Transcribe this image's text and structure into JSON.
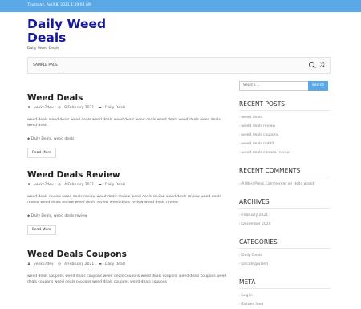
{
  "topbar": {
    "date": "Thursday, April 8, 2021 1:59:04 AM"
  },
  "site": {
    "title": "Daily Weed Deals",
    "tagline": "Daily Weed Deals"
  },
  "nav": {
    "sample_page": "SAMPLE PAGE"
  },
  "posts": [
    {
      "title": "Weed Deals",
      "author": "venko7dev",
      "date": "8 February 2021",
      "category": "Daily Deals",
      "excerpt": "weed deals weed deals weed deals weed deals weed deals weed deals weed deals weed deals weed deals weed deals",
      "tags": "Daily Deals, weed deals",
      "read_more": "Read More"
    },
    {
      "title": "Weed Deals Review",
      "author": "venko7dev",
      "date": "4 February 2021",
      "category": "Daily Deals",
      "excerpt": "weed deals review weed deals review weed deals review weed deals review weed deals review weed deals review weed deals review weed deals review weed deals review weed deals review",
      "tags": "Daily Deals, weed deals review",
      "read_more": "Read More"
    },
    {
      "title": "Weed Deals Coupons",
      "author": "venko7dev",
      "date": "4 February 2021",
      "category": "Daily Deals",
      "excerpt": "weed deals coupons weed deals coupons weed deals coupons weed deals coupons weed deals coupons weed deals coupons weed deals coupons weed deals coupons weed deals coupons",
      "tags": "",
      "read_more": ""
    }
  ],
  "sidebar": {
    "search_placeholder": "Search ...",
    "search_button": "Search",
    "recent_posts_title": "RECENT POSTS",
    "recent_posts": [
      "weed deals",
      "weed deals review",
      "weed deals coupons",
      "weed deals reddit",
      "weed deals canada review"
    ],
    "recent_comments_title": "RECENT COMMENTS",
    "recent_comment": "A WordPress Commenter on Hello world!",
    "archives_title": "ARCHIVES",
    "archives": [
      "February 2021",
      "December 2020"
    ],
    "categories_title": "CATEGORIES",
    "categories": [
      "Daily Deals",
      "Uncategorized"
    ],
    "meta_title": "META",
    "meta": [
      "Log in",
      "Entries feed"
    ]
  }
}
